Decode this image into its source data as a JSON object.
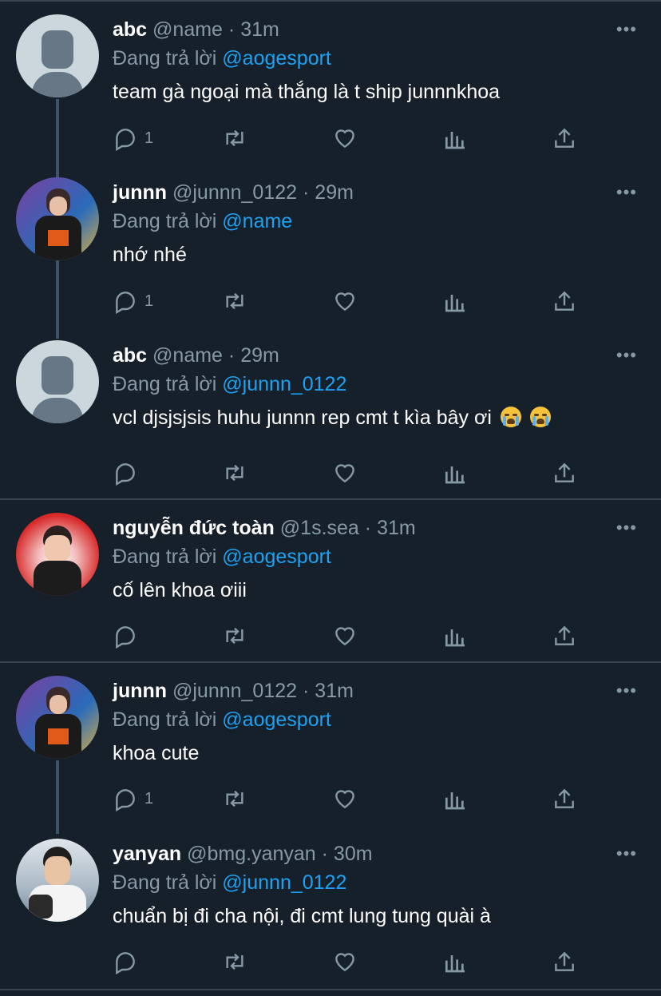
{
  "reply_prefix": "Đang trả lời",
  "colors": {
    "background": "#15202b",
    "accent": "#1da1f2",
    "muted": "#8899a6",
    "divider": "#38444d"
  },
  "tweets": [
    {
      "name": "abc",
      "handle": "@name",
      "time": "· 31m",
      "mention": "@aogesport",
      "text": "team gà ngoại mà thắng là t ship junnnkhoa",
      "reply_count": "1",
      "avatar": "default-avatar"
    },
    {
      "name": "junnn",
      "handle": "@junnn_0122",
      "time": "· 29m",
      "mention": "@name",
      "text": "nhớ nhé",
      "reply_count": "1",
      "avatar": "photo-avatar"
    },
    {
      "name": "abc",
      "handle": "@name",
      "time": "· 29m",
      "mention": "@junnn_0122",
      "text": "vcl djsjsjsis huhu junnn rep cmt t kìa bây ơi",
      "reply_count": "",
      "avatar": "default-avatar",
      "emoji": "loudly-crying-face"
    },
    {
      "name": "nguyễn đức toàn",
      "handle": "@1s.sea",
      "time": "· 31m",
      "mention": "@aogesport",
      "text": "cố lên khoa ơiii",
      "reply_count": "",
      "avatar": "photo-avatar"
    },
    {
      "name": "junnn",
      "handle": "@junnn_0122",
      "time": "· 31m",
      "mention": "@aogesport",
      "text": "khoa cute",
      "reply_count": "1",
      "avatar": "photo-avatar"
    },
    {
      "name": "yanyan",
      "handle": "@bmg.yanyan",
      "time": "· 30m",
      "mention": "@junnn_0122",
      "text": "chuẩn bị đi cha nội, đi cmt lung tung quài à",
      "reply_count": "",
      "avatar": "photo-avatar"
    }
  ],
  "more_label": "•••"
}
